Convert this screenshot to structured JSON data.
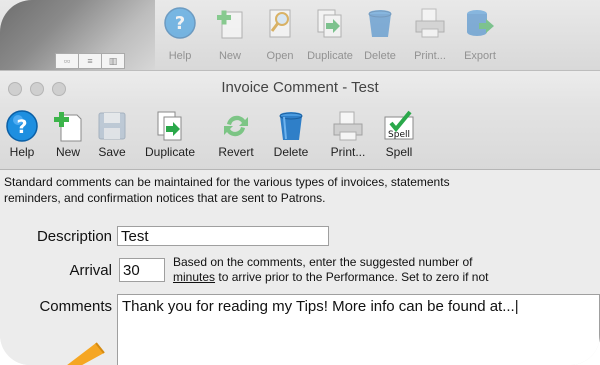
{
  "background_window": {
    "toolbar": [
      {
        "label": "Help",
        "icon": "help-icon"
      },
      {
        "label": "New",
        "icon": "new-document-icon"
      },
      {
        "label": "Open",
        "icon": "open-magnifier-icon"
      },
      {
        "label": "Duplicate",
        "icon": "duplicate-icon"
      },
      {
        "label": "Delete",
        "icon": "trash-icon"
      },
      {
        "label": "Print...",
        "icon": "printer-icon"
      },
      {
        "label": "Export",
        "icon": "export-database-icon"
      }
    ]
  },
  "window": {
    "title": "Invoice Comment - Test",
    "toolbar": [
      {
        "label": "Help",
        "icon": "help-icon"
      },
      {
        "label": "New",
        "icon": "new-document-icon"
      },
      {
        "label": "Save",
        "icon": "save-floppy-icon"
      },
      {
        "label": "Duplicate",
        "icon": "duplicate-icon"
      },
      {
        "label": "Revert",
        "icon": "revert-arrows-icon"
      },
      {
        "label": "Delete",
        "icon": "trash-icon"
      },
      {
        "label": "Print...",
        "icon": "printer-icon"
      },
      {
        "label": "Spell",
        "icon": "spell-check-icon",
        "icon_text": "Spell"
      }
    ]
  },
  "form": {
    "intro_line1": "Standard comments can be maintained for the various types of invoices, statements",
    "intro_line2": "reminders, and confirmation notices that are sent to Patrons.",
    "description_label": "Description",
    "description_value": "Test",
    "arrival_label": "Arrival",
    "arrival_value": "30",
    "arrival_hint_line1": "Based on the comments, enter the suggested number of",
    "arrival_hint_minutes": "minutes",
    "arrival_hint_line2_rest": " to arrive prior to the Performance.  Set to zero if not",
    "comments_label": "Comments",
    "comments_value": "Thank you for reading my Tips!  More info can be found at...|"
  },
  "colors": {
    "help_blue": "#1e8fe0",
    "new_green": "#3cb44a",
    "duplicate_green": "#2aa84a",
    "accent_orange": "#f5a623"
  }
}
